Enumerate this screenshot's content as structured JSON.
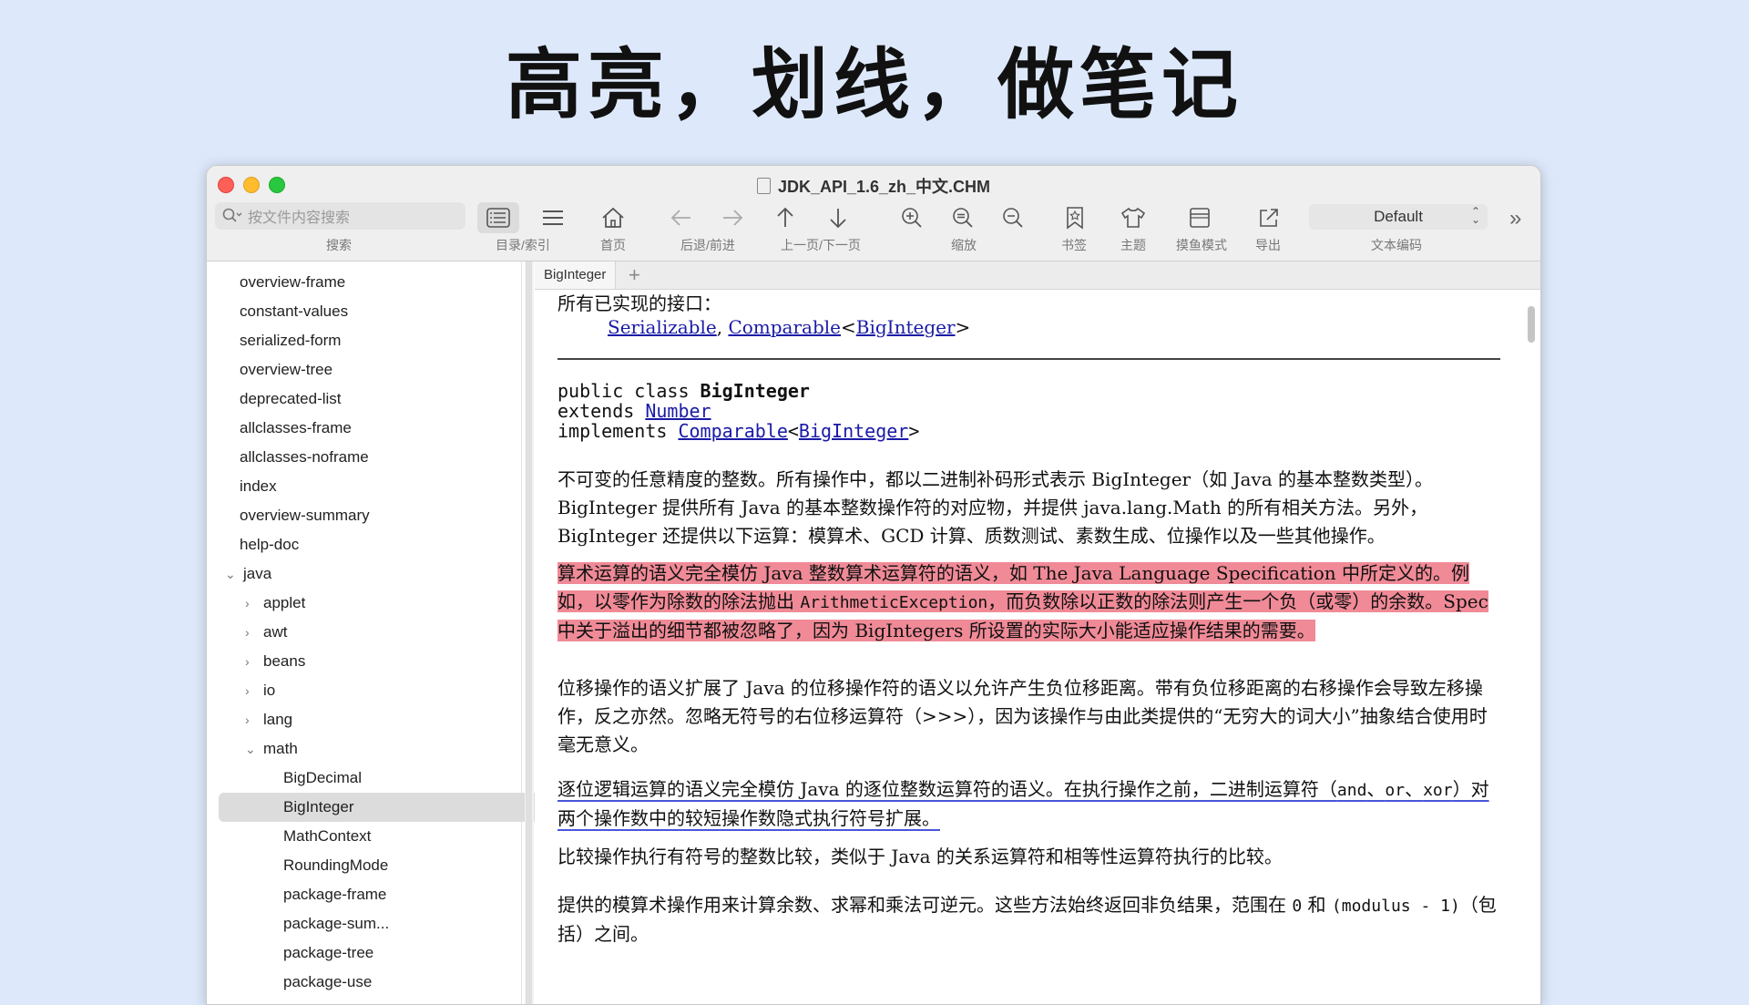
{
  "headline": "高亮，划线，做笔记",
  "window": {
    "title": "JDK_API_1.6_zh_中文.CHM"
  },
  "toolbar": {
    "search_placeholder": "按文件内容搜索",
    "search_label": "搜索",
    "toc_label": "目录/索引",
    "home_label": "首页",
    "backforward_label": "后退/前进",
    "updown_label": "上一页/下一页",
    "zoom_label": "缩放",
    "bookmark_label": "书签",
    "theme_label": "主题",
    "fishing_label": "摸鱼模式",
    "export_label": "导出",
    "encoding_label": "文本编码",
    "encoding_value": "Default"
  },
  "sidebar": {
    "items": [
      {
        "label": "overview-frame"
      },
      {
        "label": "constant-values"
      },
      {
        "label": "serialized-form"
      },
      {
        "label": "overview-tree"
      },
      {
        "label": "deprecated-list"
      },
      {
        "label": "allclasses-frame"
      },
      {
        "label": "allclasses-noframe"
      },
      {
        "label": "index"
      },
      {
        "label": "overview-summary"
      },
      {
        "label": "help-doc"
      },
      {
        "label": "java"
      },
      {
        "label": "applet"
      },
      {
        "label": "awt"
      },
      {
        "label": "beans"
      },
      {
        "label": "io"
      },
      {
        "label": "lang"
      },
      {
        "label": "math"
      },
      {
        "label": "BigDecimal"
      },
      {
        "label": "BigInteger"
      },
      {
        "label": "MathContext"
      },
      {
        "label": "RoundingMode"
      },
      {
        "label": "package-frame"
      },
      {
        "label": "package-sum..."
      },
      {
        "label": "package-tree"
      },
      {
        "label": "package-use"
      }
    ]
  },
  "tab": {
    "label": "BigInteger"
  },
  "doc": {
    "interfaces_heading": "所有已实现的接口：",
    "iface1": "Serializable",
    "iface_sep": ", ",
    "iface2": "Comparable",
    "lt": "<",
    "iface2_param": "BigInteger",
    "gt": ">",
    "decl_line1_prefix": "public class ",
    "decl_class": "BigInteger",
    "decl_extends": "extends ",
    "decl_number": "Number",
    "decl_implements": "implements ",
    "decl_comparable": "Comparable",
    "decl_param": "BigInteger",
    "p1": "不可变的任意精度的整数。所有操作中，都以二进制补码形式表示 BigInteger（如 Java 的基本整数类型）。BigInteger 提供所有 Java 的基本整数操作符的对应物，并提供 java.lang.Math 的所有相关方法。另外，BigInteger 还提供以下运算：模算术、GCD 计算、质数测试、素数生成、位操作以及一些其他操作。",
    "p2_a": "算术运算的语义完全模仿 Java 整数算术运算符的语义，如 The Java Language Specification 中所定义的。例如，以零作为除数的除法抛出 ",
    "p2_code": "ArithmeticException",
    "p2_b": "，而负数除以正数的除法则产生一个负（或零）的余数。Spec 中关于溢出的细节都被忽略了，因为 BigIntegers 所设置的实际大小能适应操作结果的需要。",
    "p3": "位移操作的语义扩展了 Java 的位移操作符的语义以允许产生负位移距离。带有负位移距离的右移操作会导致左移操作，反之亦然。忽略无符号的右位移运算符（>>>），因为该操作与由此类提供的“无穷大的词大小”抽象结合使用时毫无意义。",
    "p4_a": "逐位逻辑运算的语义完全模仿 Java 的逐位整数运算符的语义。在执行操作之前，二进制运算符（",
    "p4_code1": "and",
    "p4_sep1": "、",
    "p4_code2": "or",
    "p4_sep2": "、",
    "p4_code3": "xor",
    "p4_b": "）对两个操作数中的较短操作数隐式执行符号扩展。",
    "p5": "比较操作执行有符号的整数比较，类似于 Java 的关系运算符和相等性运算符执行的比较。",
    "p6_a": "提供的模算术操作用来计算余数、求幂和乘法可逆元。这些方法始终返回非负结果，范围在 ",
    "p6_code1": "0",
    "p6_b": " 和 ",
    "p6_code2": "(modulus - 1)",
    "p6_c": "（包括）之间。"
  },
  "colors": {
    "highlight": "#f08a97",
    "underline": "#4a55d8",
    "link": "#1a1aa6"
  }
}
